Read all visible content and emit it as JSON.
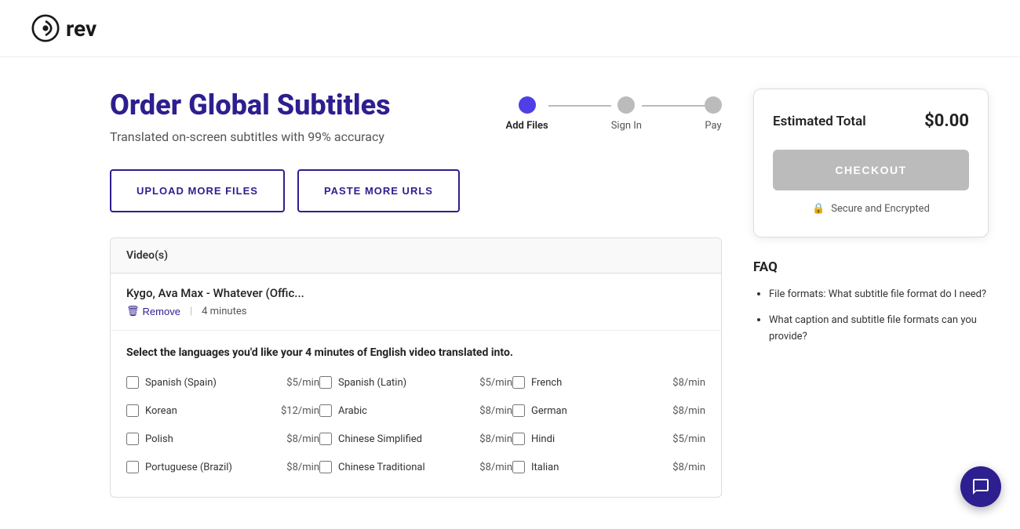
{
  "logo": {
    "text": "rev",
    "aria": "Rev logo"
  },
  "stepper": {
    "steps": [
      {
        "label": "Add Files",
        "state": "active"
      },
      {
        "label": "Sign In",
        "state": "inactive"
      },
      {
        "label": "Pay",
        "state": "inactive"
      }
    ]
  },
  "page": {
    "title": "Order Global Subtitles",
    "subtitle": "Translated on-screen subtitles with 99% accuracy"
  },
  "buttons": {
    "upload": "UPLOAD MORE FILES",
    "paste": "PASTE MORE URLS"
  },
  "table": {
    "header": "Video(s)",
    "file": {
      "name": "Kygo, Ava Max - Whatever (Offic...",
      "remove_label": "Remove",
      "duration": "4 minutes"
    },
    "language_prompt": "Select the languages you'd like your 4 minutes of English video translated into.",
    "languages": [
      {
        "name": "Spanish (Spain)",
        "price": "$5/min"
      },
      {
        "name": "Spanish (Latin)",
        "price": "$5/min"
      },
      {
        "name": "French",
        "price": "$8/min"
      },
      {
        "name": "Korean",
        "price": "$12/min"
      },
      {
        "name": "Arabic",
        "price": "$8/min"
      },
      {
        "name": "German",
        "price": "$8/min"
      },
      {
        "name": "Polish",
        "price": "$8/min"
      },
      {
        "name": "Chinese Simplified",
        "price": "$8/min"
      },
      {
        "name": "Hindi",
        "price": "$5/min"
      },
      {
        "name": "Portuguese (Brazil)",
        "price": "$8/min"
      },
      {
        "name": "Chinese Traditional",
        "price": "$8/min"
      },
      {
        "name": "Italian",
        "price": "$8/min"
      }
    ]
  },
  "order_summary": {
    "estimated_label": "Estimated Total",
    "estimated_amount": "$0.00",
    "checkout_label": "CHECKOUT",
    "secure_label": "Secure and Encrypted"
  },
  "faq": {
    "title": "FAQ",
    "items": [
      {
        "text": "File formats: What subtitle file format do I need?"
      },
      {
        "text": "What caption and subtitle file formats can you provide?"
      }
    ]
  },
  "chat": {
    "label": "Chat support"
  }
}
